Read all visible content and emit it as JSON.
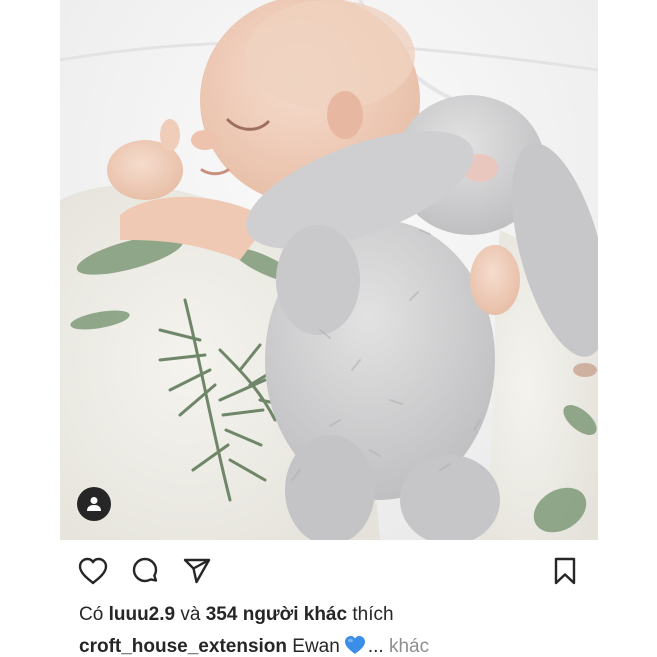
{
  "post": {
    "photo": {
      "tag_icon": "user-tag-icon"
    },
    "actions": {
      "like_icon": "heart-outline-icon",
      "comment_icon": "comment-icon",
      "share_icon": "paper-plane-icon",
      "save_icon": "bookmark-icon"
    },
    "likes": {
      "prefix": "Có",
      "first_user": "luuu2.9",
      "conjunction": "và",
      "others_count": "354 người khác",
      "suffix": "thích"
    },
    "caption": {
      "username": "croft_house_extension",
      "text": "Ewan",
      "emoji_icon": "blue-heart-icon",
      "more_dots": "...",
      "more_label": "khác"
    }
  },
  "colors": {
    "text": "#262626",
    "muted": "#8e8e8e",
    "emoji_blue": "#3b8ee8"
  }
}
